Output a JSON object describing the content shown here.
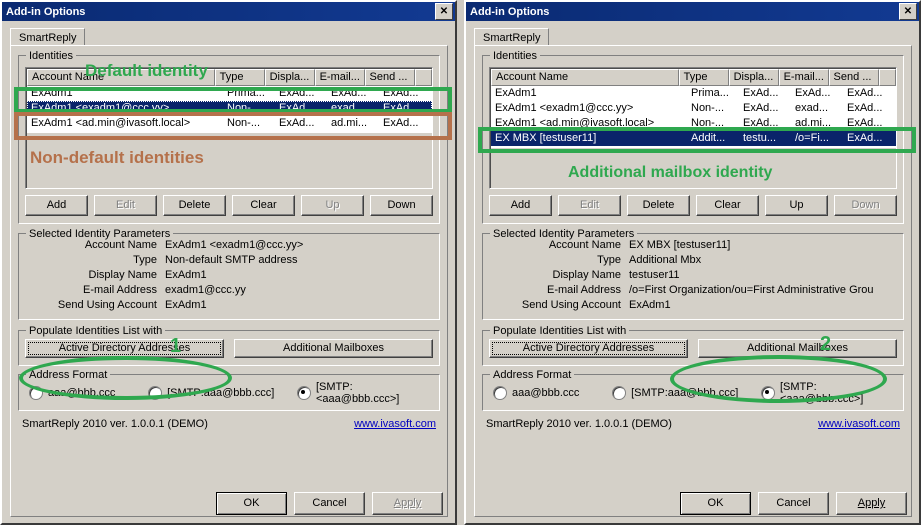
{
  "colors": {
    "annotation_green": "#2fa84f",
    "annotation_brown": "#b5714b",
    "titlebar": "#0a246a",
    "dialog_face": "#d4d0c8",
    "selection": "#0a246a",
    "link": "#0000c0"
  },
  "window": {
    "title": "Add-in Options",
    "close_label": "✕"
  },
  "tab": {
    "label": "SmartReply"
  },
  "groups": {
    "identities": "Identities",
    "selected_params": "Selected Identity Parameters",
    "populate": "Populate Identities List with",
    "address_format": "Address Format"
  },
  "list_columns": [
    "Account Name",
    "Type",
    "Displa...",
    "E-mail...",
    "Send ..."
  ],
  "list_buttons": [
    "Add",
    "Edit",
    "Delete",
    "Clear",
    "Up",
    "Down"
  ],
  "populate_buttons": {
    "active_directory": "Active Directory Addresses",
    "additional_mailboxes": "Additional Mailboxes"
  },
  "address_format_options": [
    "aaa@bbb.ccc",
    "[SMTP:aaa@bbb.ccc]",
    "[SMTP:<aaa@bbb.ccc>]"
  ],
  "address_format_selected_index": 2,
  "footer": {
    "version": "SmartReply 2010 ver. 1.0.0.1 (DEMO)",
    "link": "www.ivasoft.com"
  },
  "dialog_buttons": {
    "ok": "OK",
    "cancel": "Cancel",
    "apply": "Apply"
  },
  "param_labels": {
    "account_name": "Account Name",
    "type": "Type",
    "display_name": "Display Name",
    "email_address": "E-mail Address",
    "send_using_account": "Send Using Account"
  },
  "left": {
    "rows": [
      {
        "account": "ExAdm1",
        "type": "Prima...",
        "display": "ExAd...",
        "email": "ExAd...",
        "send": "ExAd...",
        "selected": false
      },
      {
        "account": "ExAdm1 <exadm1@ccc.yy>",
        "type": "Non-...",
        "display": "ExAd...",
        "email": "exad...",
        "send": "ExAd...",
        "selected": true
      },
      {
        "account": "ExAdm1 <ad.min@ivasoft.local>",
        "type": "Non-...",
        "display": "ExAd...",
        "email": "ad.mi...",
        "send": "ExAd...",
        "selected": false
      }
    ],
    "button_states": {
      "Add": "enabled",
      "Edit": "disabled",
      "Delete": "enabled",
      "Clear": "enabled",
      "Up": "disabled",
      "Down": "enabled"
    },
    "params": {
      "account_name": "ExAdm1 <exadm1@ccc.yy>",
      "type": "Non-default SMTP address",
      "display_name": "ExAdm1",
      "email_address": "exadm1@ccc.yy",
      "send_using_account": "ExAdm1"
    },
    "apply_enabled": false,
    "annotations": {
      "default_identity": "Default identity",
      "non_default_identities": "Non-default identities",
      "step_number": "1"
    }
  },
  "right": {
    "rows": [
      {
        "account": "ExAdm1",
        "type": "Prima...",
        "display": "ExAd...",
        "email": "ExAd...",
        "send": "ExAd...",
        "selected": false
      },
      {
        "account": "ExAdm1 <exadm1@ccc.yy>",
        "type": "Non-...",
        "display": "ExAd...",
        "email": "exad...",
        "send": "ExAd...",
        "selected": false
      },
      {
        "account": "ExAdm1 <ad.min@ivasoft.local>",
        "type": "Non-...",
        "display": "ExAd...",
        "email": "ad.mi...",
        "send": "ExAd...",
        "selected": false
      },
      {
        "account": "EX MBX [testuser11]",
        "type": "Addit...",
        "display": "testu...",
        "email": "/o=Fi...",
        "send": "ExAd...",
        "selected": true
      }
    ],
    "button_states": {
      "Add": "enabled",
      "Edit": "disabled",
      "Delete": "enabled",
      "Clear": "enabled",
      "Up": "enabled",
      "Down": "disabled"
    },
    "params": {
      "account_name": "EX MBX [testuser11]",
      "type": "Additional Mbx",
      "display_name": "testuser11",
      "email_address": "/o=First Organization/ou=First Administrative Grou",
      "send_using_account": "ExAdm1"
    },
    "apply_enabled": true,
    "annotations": {
      "additional_mailbox_identity": "Additional mailbox identity",
      "step_number": "2"
    }
  }
}
